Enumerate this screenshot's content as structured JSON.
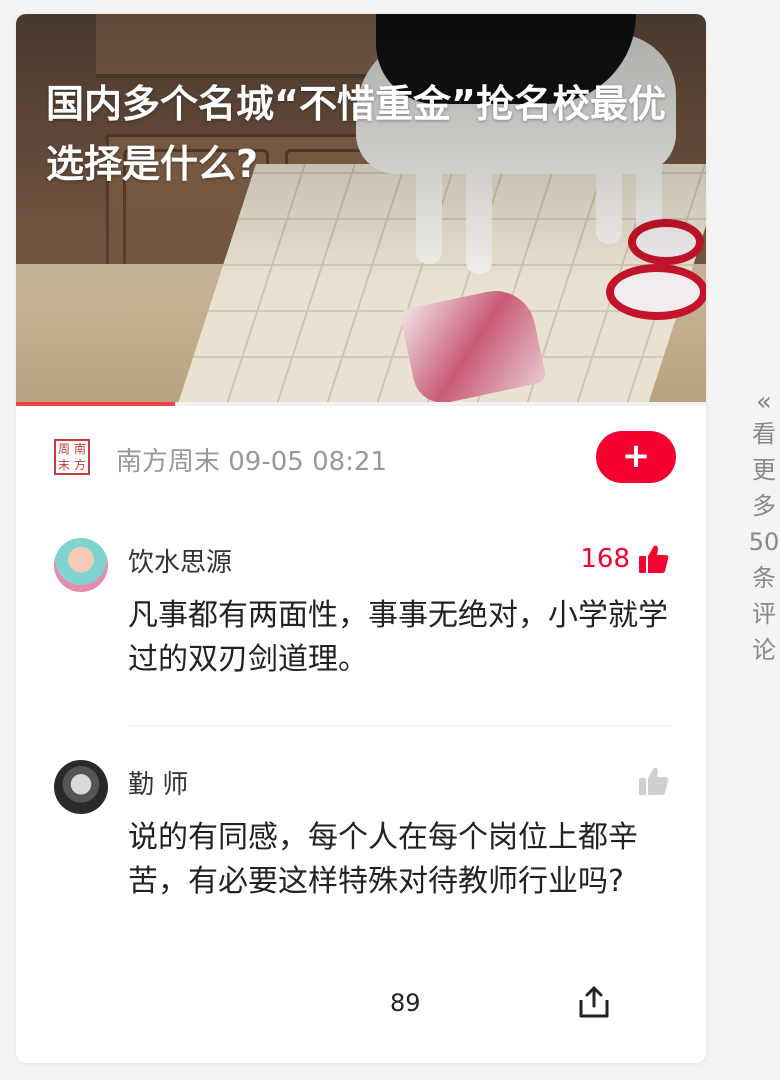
{
  "headline": "国内多个名城“不惜重金”抢名校最优选择是什么?",
  "video_progress_pct": 23,
  "source": {
    "logo_chars": [
      "周",
      "南",
      "末",
      "方"
    ],
    "meta": "南方周末 09-05 08:21",
    "follow_label": "+"
  },
  "comments": [
    {
      "name": "饮水思源",
      "likes": "168",
      "liked": true,
      "text": "凡事都有两面性，事事无绝对，小学就学过的双刃剑道理。"
    },
    {
      "name": "勤 师",
      "likes": "",
      "liked": false,
      "text": "说的有同感，每个人在每个岗位上都辛苦，有必要这样特殊对待教师行业吗?"
    }
  ],
  "footer": {
    "comment_count": "89",
    "share_icon": "share-icon"
  },
  "more_comments": {
    "chevron": "«",
    "chars": [
      "看",
      "更",
      "多",
      "50",
      "条",
      "评",
      "论"
    ]
  },
  "colors": {
    "accent": "#f5002f",
    "progress": "#f04142"
  }
}
